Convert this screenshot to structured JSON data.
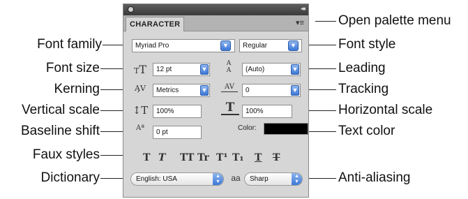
{
  "callouts": {
    "font_family": "Font family",
    "font_size": "Font size",
    "kerning": "Kerning",
    "vertical_scale": "Vertical scale",
    "baseline_shift": "Baseline shift",
    "faux_styles": "Faux styles",
    "dictionary": "Dictionary",
    "open_palette_menu": "Open palette menu",
    "font_style": "Font style",
    "leading": "Leading",
    "tracking": "Tracking",
    "horizontal_scale": "Horizontal scale",
    "text_color": "Text color",
    "anti_aliasing": "Anti-aliasing"
  },
  "panel": {
    "tab_label": "CHARACTER",
    "collapse_glyph": "◂◂",
    "menu_glyph": "▾≡",
    "font_family_value": "Myriad Pro",
    "font_style_value": "Regular",
    "font_size_value": "12 pt",
    "leading_value": "(Auto)",
    "kerning_value": "Metrics",
    "tracking_value": "0",
    "vertical_scale_value": "100%",
    "horizontal_scale_value": "100%",
    "baseline_shift_value": "0 pt",
    "color_label": "Color:",
    "text_color": "#000000",
    "dictionary_value": "English: USA",
    "anti_alias_value": "Sharp",
    "anti_alias_icon": "aa"
  },
  "icons": {
    "font_size": "font-size-icon",
    "leading": "leading-icon",
    "kerning": "kerning-icon",
    "tracking": "tracking-icon",
    "vertical_scale": "vertical-scale-icon",
    "horizontal_scale": "horizontal-scale-icon",
    "baseline_shift": "baseline-shift-icon"
  },
  "faux_buttons": [
    "T",
    "T",
    "TT",
    "Tr",
    "T¹",
    "T₁",
    "T",
    "T"
  ]
}
